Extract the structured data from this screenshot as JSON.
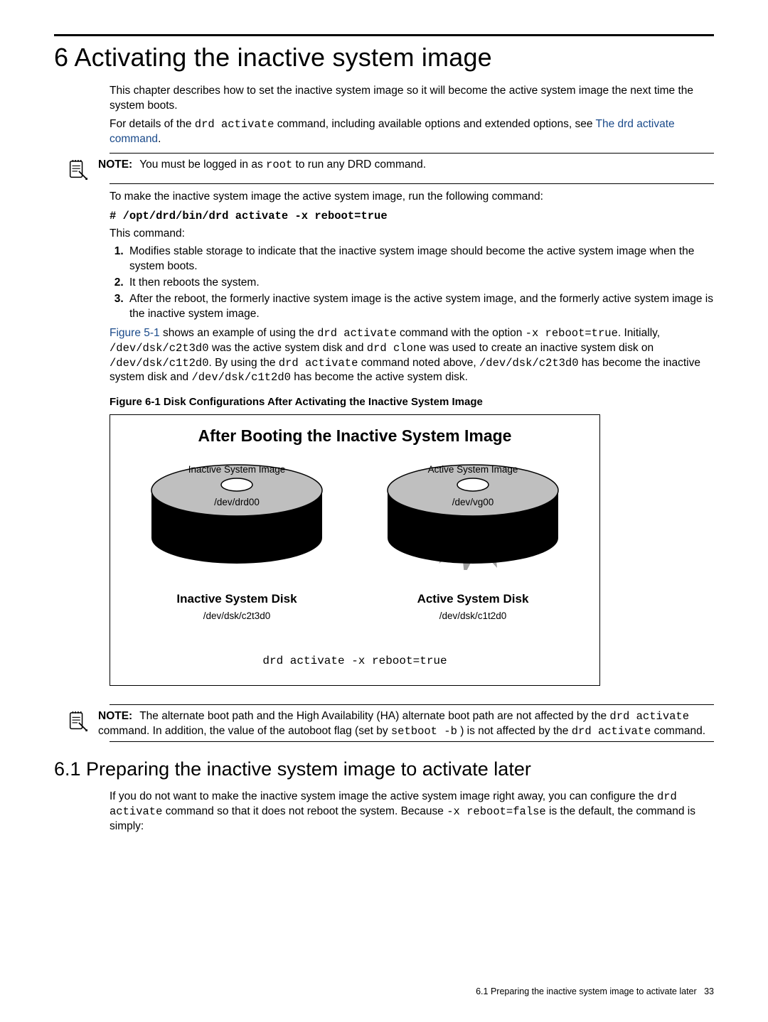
{
  "chapter": {
    "number": "6",
    "title": "Activating the inactive system image"
  },
  "intro": {
    "p1": "This chapter describes how to set the inactive system image so it will become the active system image the next time the system boots.",
    "p2a": "For details of the ",
    "p2_cmd": "drd activate",
    "p2b": " command, including available options and extended options, see ",
    "p2_link": "The drd activate command",
    "p2c": "."
  },
  "note1": {
    "label": "NOTE:",
    "a": "You must be logged in as ",
    "root": "root",
    "b": " to run any DRD command."
  },
  "run": {
    "lead": "To make the inactive system image the active system image, run the following command:",
    "cmd": "# /opt/drd/bin/drd activate -x reboot=true",
    "this": "This command:"
  },
  "steps": {
    "s1": "Modifies stable storage to indicate that the inactive system image should become the active system image when the system boots.",
    "s2": "It then reboots the system.",
    "s3": "After the reboot, the formerly inactive system image is the active system image, and the formerly active system image is the inactive system image."
  },
  "example": {
    "fig_ref": "Figure 5-1",
    "t1": " shows an example of using the ",
    "c1": "drd activate",
    "t2": " command with the option ",
    "c2": "-x reboot=true",
    "t3": ". Initially, ",
    "c3": "/dev/dsk/c2t3d0",
    "t4": " was the active system disk and ",
    "c4": "drd clone",
    "t5": " was used to create an inactive system disk on ",
    "c5": "/dev/dsk/c1t2d0",
    "t6": ". By using the ",
    "c6": "drd activate",
    "t7": " command noted above, ",
    "c7": "/dev/dsk/c2t3d0",
    "t8": " has become the inactive system disk and ",
    "c8": "/dev/dsk/c1t2d0",
    "t9": " has become the active system disk."
  },
  "figure": {
    "caption": "Figure 6-1 Disk Configurations After Activating the Inactive System Image",
    "title": "After Booting the Inactive System Image",
    "left": {
      "top": "Inactive System Image",
      "dev": "/dev/drd00",
      "subtitle": "Inactive System Disk",
      "path": "/dev/dsk/c2t3d0"
    },
    "right": {
      "top": "Active System Image",
      "dev": "/dev/vg00",
      "subtitle": "Active System Disk",
      "path": "/dev/dsk/c1t2d0"
    },
    "cmd": "drd activate -x reboot=true"
  },
  "note2": {
    "label": "NOTE:",
    "t1": "The alternate boot path and the High Availability (HA) alternate boot path are not affected by the ",
    "c1": "drd activate",
    "t2": " command. In addition, the value of the autoboot flag (set by ",
    "c2": "setboot -b",
    "t3": " ) is not affected by the ",
    "c3": "drd activate",
    "t4": " command."
  },
  "section61": {
    "heading": "6.1 Preparing the inactive system image to activate later",
    "t1": "If you do not want to make the inactive system image the active system image right away, you can configure the ",
    "c1": "drd activate",
    "t2": " command so that it does not reboot the system. Because ",
    "c2": "-x reboot=false",
    "t3": " is the default, the command is simply:"
  },
  "footer": {
    "text": "6.1 Preparing the inactive system image to activate later",
    "page": "33"
  }
}
